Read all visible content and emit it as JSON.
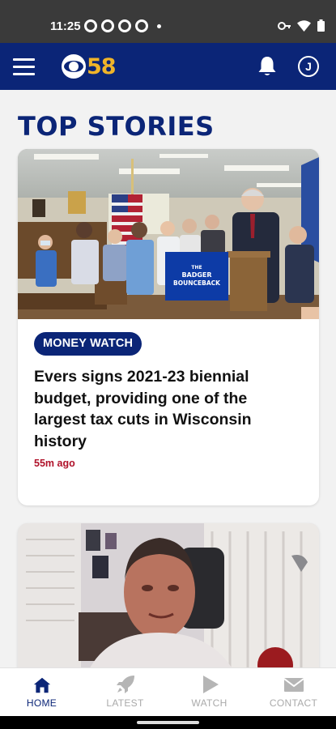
{
  "status_bar": {
    "time": "11:25",
    "notification_icons": [
      "app-icon",
      "app-icon",
      "app-icon",
      "app-icon"
    ],
    "system_icons": [
      "vpn-key-icon",
      "wifi-icon",
      "battery-icon"
    ]
  },
  "app_bar": {
    "logo_number": "58",
    "account_initial": "J",
    "brand_color": "#0b2577",
    "logo_accent": "#f0b429"
  },
  "main": {
    "section_title": "TOP STORIES",
    "stories": [
      {
        "category": "MONEY WATCH",
        "headline": "Evers signs 2021-23 biennial budget, providing one of the largest tax cuts in Wisconsin history",
        "time_ago": "55m ago",
        "podium_sign_line1": "THE",
        "podium_sign_line2": "BADGER",
        "podium_sign_line3": "BOUNCEBACK"
      }
    ]
  },
  "bottom_nav": {
    "items": [
      {
        "label": "HOME",
        "icon": "home-icon",
        "active": true
      },
      {
        "label": "LATEST",
        "icon": "rocket-icon",
        "active": false
      },
      {
        "label": "WATCH",
        "icon": "play-icon",
        "active": false
      },
      {
        "label": "CONTACT",
        "icon": "envelope-icon",
        "active": false
      }
    ]
  }
}
